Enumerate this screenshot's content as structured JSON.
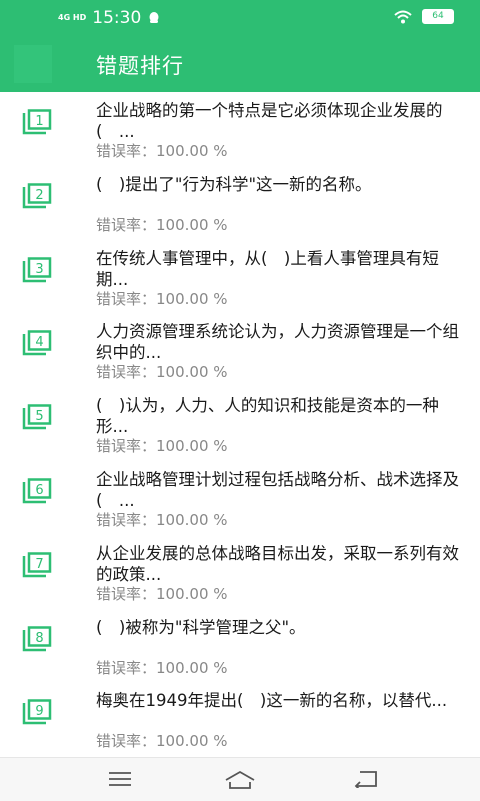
{
  "status": {
    "network": "4G HD",
    "time": "15:30",
    "battery": "64",
    "accent": "#2dbe73"
  },
  "header": {
    "title": "错题排行"
  },
  "items": [
    {
      "num": "1",
      "text": "企业战略的第一个特点是它必须体现企业发展的(　...",
      "rate": "错误率：100.00 %"
    },
    {
      "num": "2",
      "text": "(　)提出了\"行为科学\"这一新的名称。",
      "rate": "错误率：100.00 %"
    },
    {
      "num": "3",
      "text": "在传统人事管理中，从(　)上看人事管理具有短期...",
      "rate": "错误率：100.00 %"
    },
    {
      "num": "4",
      "text": "人力资源管理系统论认为，人力资源管理是一个组织中的...",
      "rate": "错误率：100.00 %"
    },
    {
      "num": "5",
      "text": "(　)认为，人力、人的知识和技能是资本的一种形...",
      "rate": "错误率：100.00 %"
    },
    {
      "num": "6",
      "text": "企业战略管理计划过程包括战略分析、战术选择及(　...",
      "rate": "错误率：100.00 %"
    },
    {
      "num": "7",
      "text": "从企业发展的总体战略目标出发，采取一系列有效的政策...",
      "rate": "错误率：100.00 %"
    },
    {
      "num": "8",
      "text": "(　)被称为\"科学管理之父\"。",
      "rate": "错误率：100.00 %"
    },
    {
      "num": "9",
      "text": "梅奥在1949年提出(　)这一新的名称，以替代...",
      "rate": "错误率：100.00 %"
    }
  ],
  "icons": {
    "item": "numbered-stack-icon",
    "nav_menu": "menu-icon",
    "nav_home": "home-icon",
    "nav_back": "back-icon"
  }
}
